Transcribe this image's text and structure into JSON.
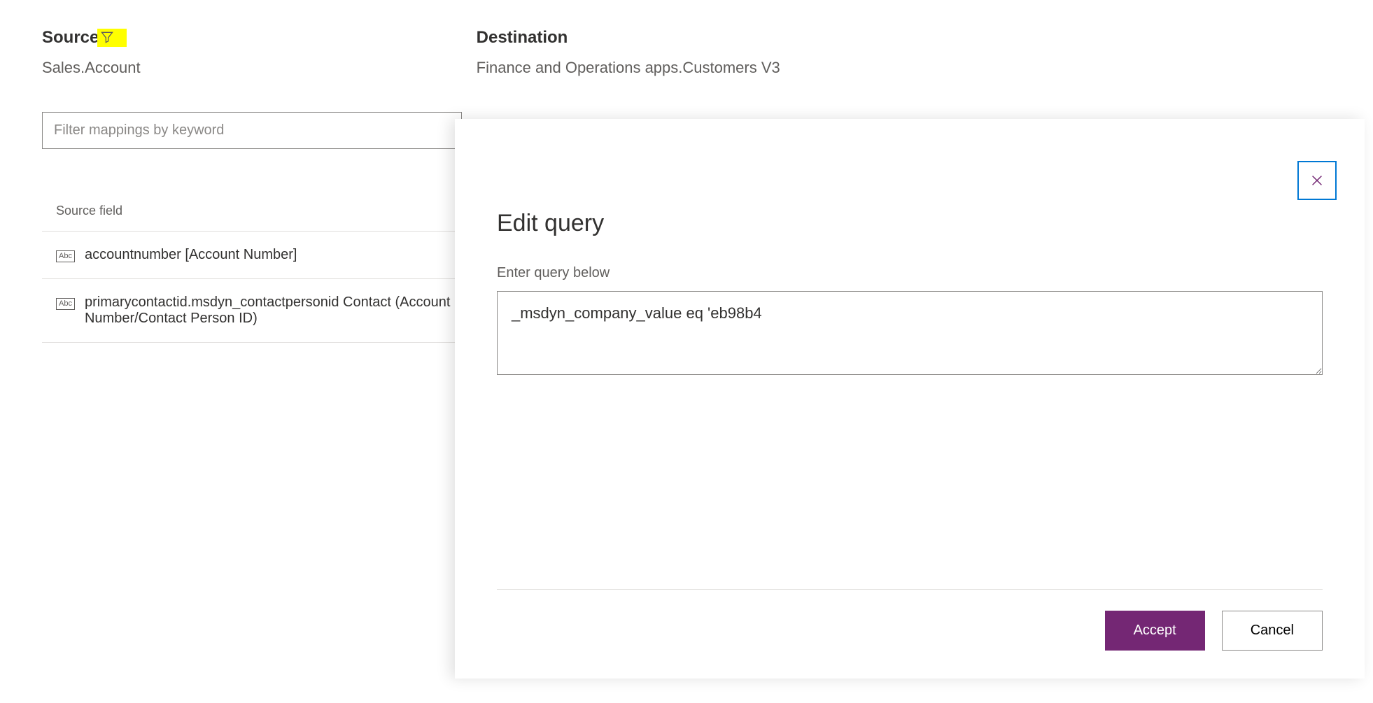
{
  "header": {
    "source_label": "Source",
    "source_value": "Sales.Account",
    "destination_label": "Destination",
    "destination_value": "Finance and Operations apps.Customers V3"
  },
  "filter": {
    "placeholder": "Filter mappings by keyword"
  },
  "list": {
    "column_header": "Source field",
    "rows": [
      {
        "icon": "Abc",
        "text": "accountnumber [Account Number]"
      },
      {
        "icon": "Abc",
        "text": "primarycontactid.msdyn_contactpersonid Contact (Account Number/Contact Person ID)"
      }
    ]
  },
  "modal": {
    "title": "Edit query",
    "label": "Enter query below",
    "query_value": "_msdyn_company_value eq 'eb98b4",
    "accept": "Accept",
    "cancel": "Cancel"
  }
}
